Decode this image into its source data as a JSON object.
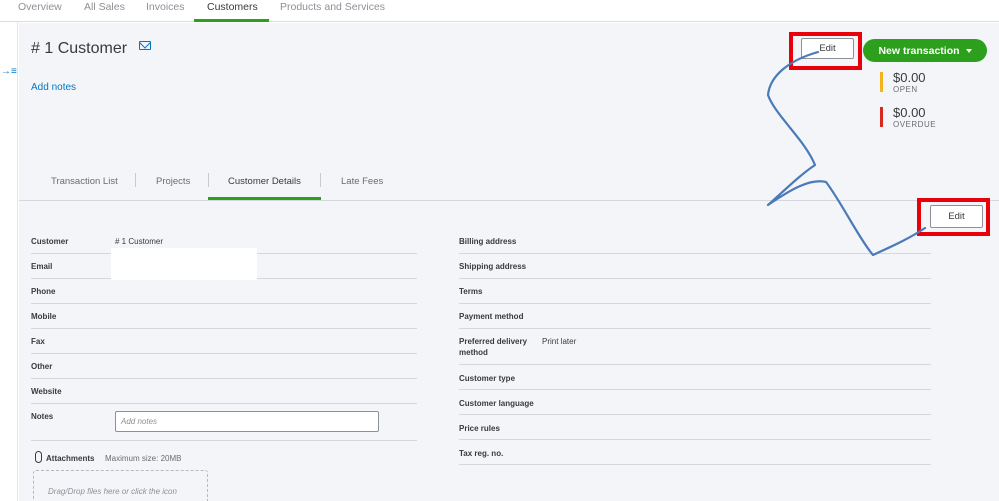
{
  "topnav": {
    "tabs": [
      {
        "label": "Overview"
      },
      {
        "label": "All Sales"
      },
      {
        "label": "Invoices"
      },
      {
        "label": "Customers"
      },
      {
        "label": "Products and Services"
      }
    ],
    "active": "Customers"
  },
  "header": {
    "title": "# 1 Customer",
    "add_notes": "Add notes",
    "edit_label": "Edit",
    "new_transaction_label": "New transaction"
  },
  "summary": [
    {
      "amount": "$0.00",
      "label": "OPEN",
      "color": "#f2b41c"
    },
    {
      "amount": "$0.00",
      "label": "OVERDUE",
      "color": "#d52b1e"
    }
  ],
  "tabs": [
    {
      "label": "Transaction List"
    },
    {
      "label": "Projects"
    },
    {
      "label": "Customer Details"
    },
    {
      "label": "Late Fees"
    }
  ],
  "active_tab": "Customer Details",
  "details_edit_label": "Edit",
  "details_left": [
    {
      "label": "Customer",
      "value": "# 1 Customer"
    },
    {
      "label": "Email",
      "value": ""
    },
    {
      "label": "Phone",
      "value": ""
    },
    {
      "label": "Mobile",
      "value": ""
    },
    {
      "label": "Fax",
      "value": ""
    },
    {
      "label": "Other",
      "value": ""
    },
    {
      "label": "Website",
      "value": ""
    },
    {
      "label": "Notes",
      "value": ""
    }
  ],
  "notes_placeholder": "Add notes",
  "details_right": [
    {
      "label": "Billing address",
      "value": ""
    },
    {
      "label": "Shipping address",
      "value": ""
    },
    {
      "label": "Terms",
      "value": ""
    },
    {
      "label": "Payment method",
      "value": ""
    },
    {
      "label": "Preferred delivery",
      "label2": "method",
      "value": "Print later"
    },
    {
      "label": "Customer type",
      "value": ""
    },
    {
      "label": "Customer language",
      "value": ""
    },
    {
      "label": "Price rules",
      "value": ""
    },
    {
      "label": "Tax reg. no.",
      "value": ""
    }
  ],
  "attachments": {
    "label": "Attachments",
    "max_size": "Maximum size: 20MB",
    "dropzone_text": "Drag/Drop files here or click the icon"
  },
  "colors": {
    "accent_green": "#2ca01c",
    "link_blue": "#0077c5",
    "highlight_red": "#e8000b",
    "annotation_blue": "#4a7ab8"
  }
}
